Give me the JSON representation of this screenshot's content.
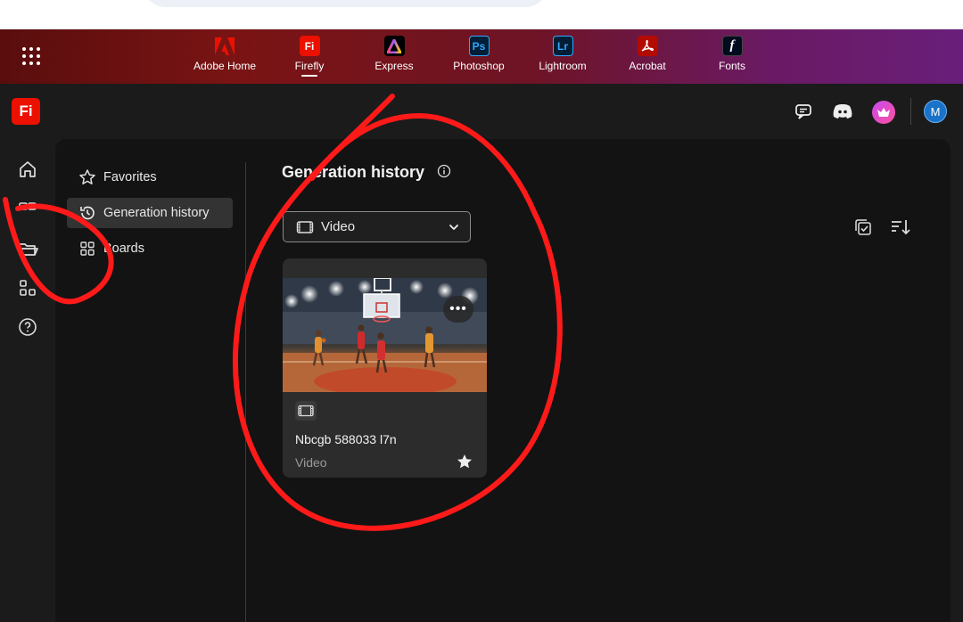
{
  "apps": [
    {
      "label": "Adobe Home",
      "icon": "adobe-logo-icon",
      "color": "#eb1000"
    },
    {
      "label": "Firefly",
      "icon": "firefly-icon",
      "color": "#eb1000",
      "active": true
    },
    {
      "label": "Express",
      "icon": "express-icon",
      "color": "#000000"
    },
    {
      "label": "Photoshop",
      "icon": "photoshop-icon",
      "color": "#001e36"
    },
    {
      "label": "Lightroom",
      "icon": "lightroom-icon",
      "color": "#001e36"
    },
    {
      "label": "Acrobat",
      "icon": "acrobat-icon",
      "color": "#b30b00"
    },
    {
      "label": "Fonts",
      "icon": "fonts-icon",
      "color": "#000b1d"
    }
  ],
  "app_tiles": {
    "firefly": "Fi",
    "photoshop": "Ps",
    "lightroom": "Lr",
    "fonts": "f"
  },
  "logo": "Fi",
  "avatar_initial": "M",
  "nav": {
    "favorites": "Favorites",
    "generation_history": "Generation history",
    "boards": "Boards"
  },
  "main": {
    "title": "Generation history",
    "filter": "Video"
  },
  "card": {
    "name": "Nbcgb 588033 l7n",
    "type": "Video",
    "more": "•••"
  },
  "colors": {
    "accent": "#eb1000",
    "annotation": "#ff1a1a",
    "active_nav": "#333333"
  }
}
